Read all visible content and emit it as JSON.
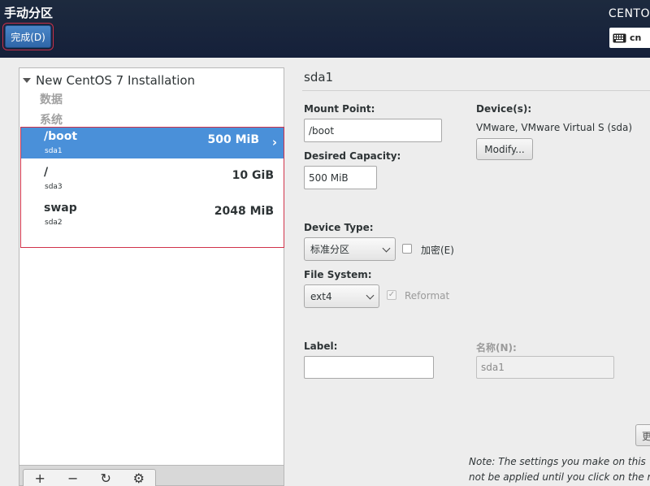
{
  "header": {
    "title": "手动分区",
    "done_label": "完成(D)",
    "product": "CENTO",
    "keyboard_layout": "cn"
  },
  "tree": {
    "root_label": "New CentOS 7 Installation",
    "group_data": "数据",
    "group_system": "系统",
    "partitions": [
      {
        "name": "/boot",
        "device": "sda1",
        "size": "500 MiB",
        "selected": true
      },
      {
        "name": "/",
        "device": "sda3",
        "size": "10 GiB",
        "selected": false
      },
      {
        "name": "swap",
        "device": "sda2",
        "size": "2048 MiB",
        "selected": false
      }
    ]
  },
  "toolbar": {
    "add": "+",
    "remove": "−",
    "refresh": "↻",
    "configure": "⚙"
  },
  "details": {
    "title": "sda1",
    "mount_point_label": "Mount Point:",
    "mount_point_value": "/boot",
    "desired_capacity_label": "Desired Capacity:",
    "desired_capacity_value": "500 MiB",
    "devices_label": "Device(s):",
    "devices_value": "VMware, VMware Virtual S (sda)",
    "modify_label": "Modify...",
    "device_type_label": "Device Type:",
    "device_type_value": "标准分区",
    "encrypt_label": "加密(E)",
    "file_system_label": "File System:",
    "file_system_value": "ext4",
    "reformat_label": "Reformat",
    "label_label": "Label:",
    "label_value": "",
    "name_label": "名称(N):",
    "name_value": "sda1",
    "edge_button_label": "更",
    "note_line1": "Note:  The settings you make on this",
    "note_line2": "not be applied until you click on the m"
  }
}
